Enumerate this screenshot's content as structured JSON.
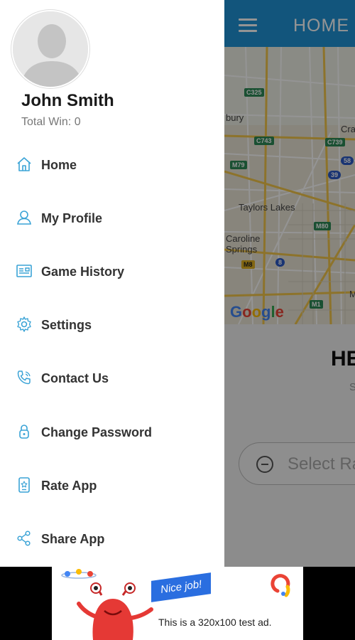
{
  "app_bar": {
    "title": "HOME",
    "menu_icon": "hamburger-menu-icon"
  },
  "map": {
    "labels": [
      "bury",
      "Cra",
      "Taylors Lakes",
      "Caroline",
      "Springs",
      "M"
    ],
    "road_badges": [
      "C325",
      "C743",
      "C739",
      "M79",
      "58",
      "39",
      "M80",
      "M8",
      "8",
      "M1"
    ],
    "attribution": "Google"
  },
  "main": {
    "heading": "HE",
    "subtext": "S",
    "select_placeholder": "Select Ra"
  },
  "drawer": {
    "user_name": "John Smith",
    "total_win": "Total Win: 0",
    "items": [
      {
        "label": "Home",
        "icon": "home-icon"
      },
      {
        "label": "My Profile",
        "icon": "user-icon"
      },
      {
        "label": "Game History",
        "icon": "history-icon"
      },
      {
        "label": "Settings",
        "icon": "gear-icon"
      },
      {
        "label": "Contact Us",
        "icon": "phone-icon"
      },
      {
        "label": "Change Password",
        "icon": "lock-icon"
      },
      {
        "label": "Rate App",
        "icon": "rate-icon"
      },
      {
        "label": "Share App",
        "icon": "share-icon"
      }
    ]
  },
  "ad": {
    "badge": "Nice job!",
    "text": "This is a 320x100 test ad."
  },
  "colors": {
    "app_bar": "#1f93d6",
    "icon_accent": "#3aa3d6",
    "drawer_bg": "#ffffff"
  }
}
